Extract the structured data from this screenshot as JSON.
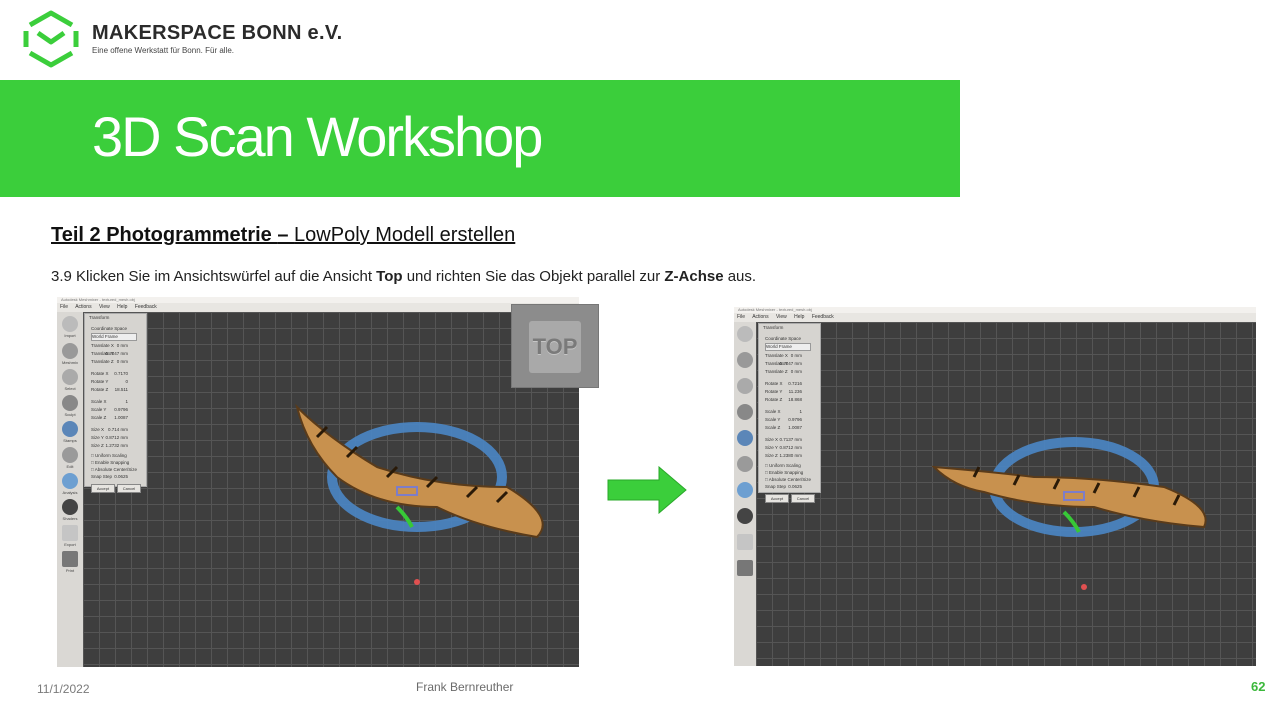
{
  "header": {
    "org_name": "MAKERSPACE BONN e.V.",
    "tagline": "Eine offene Werkstatt für Bonn. Für alle.",
    "brand_color": "#3bce3b"
  },
  "banner": {
    "title": "3D Scan Workshop"
  },
  "section": {
    "subtitle_bold": "Teil 2  Photogrammetrie ",
    "subtitle_dash": "– ",
    "subtitle_rest": "LowPoly Modell erstellen"
  },
  "instruction": {
    "part1": "3.9 Klicken Sie im Ansichtswürfel auf die Ansicht ",
    "bold1": "Top",
    "part2": " und richten Sie das Objekt parallel zur ",
    "bold2": "Z-Achse",
    "part3": " aus."
  },
  "screenshot_left": {
    "window_title": "Autodesk Meshmixer - textured_mesh.obj",
    "menu": [
      "File",
      "Actions",
      "View",
      "Help",
      "Feedback"
    ],
    "panel": {
      "title": "Transform",
      "coord_label": "Coordinate Space",
      "coord_value": "World Frame",
      "rows": [
        {
          "label": "Translate X",
          "value": "0",
          "unit": "mm"
        },
        {
          "label": "Translate Y",
          "value": "0.2047",
          "unit": "mm"
        },
        {
          "label": "Translate Z",
          "value": "0",
          "unit": "mm"
        },
        {
          "label": "Rotate X",
          "value": "0.7170",
          "unit": ""
        },
        {
          "label": "Rotate Y",
          "value": "0",
          "unit": ""
        },
        {
          "label": "Rotate Z",
          "value": "18.511",
          "unit": ""
        },
        {
          "label": "Scale X",
          "value": "1",
          "unit": ""
        },
        {
          "label": "Scale Y",
          "value": "0.9796",
          "unit": ""
        },
        {
          "label": "Scale Z",
          "value": "1.0087",
          "unit": ""
        },
        {
          "label": "Size X",
          "value": "0.714",
          "unit": "mm"
        },
        {
          "label": "Size Y",
          "value": "0.8712",
          "unit": "mm"
        },
        {
          "label": "Size Z",
          "value": "1.2732",
          "unit": "mm"
        }
      ],
      "checkboxes": [
        "Uniform Scaling",
        "Enable Snapping",
        "Absolute Center/Size"
      ],
      "snap_label": "Snap Step",
      "snap_value": "0.0625",
      "accept": "Accept",
      "cancel": "Cancel"
    },
    "viewcube_label": "TOP"
  },
  "screenshot_right": {
    "window_title": "Autodesk Meshmixer - textured_mesh.obj",
    "menu": [
      "File",
      "Actions",
      "View",
      "Help",
      "Feedback"
    ],
    "panel": {
      "title": "Transform",
      "coord_label": "Coordinate Space",
      "coord_value": "World Frame",
      "rows": [
        {
          "label": "Translate X",
          "value": "0",
          "unit": "mm"
        },
        {
          "label": "Translate Y",
          "value": "0.2047",
          "unit": "mm"
        },
        {
          "label": "Translate Z",
          "value": "0",
          "unit": "mm"
        },
        {
          "label": "Rotate X",
          "value": "0.7216",
          "unit": ""
        },
        {
          "label": "Rotate Y",
          "value": "11.236",
          "unit": ""
        },
        {
          "label": "Rotate Z",
          "value": "18.868",
          "unit": ""
        },
        {
          "label": "Scale X",
          "value": "1",
          "unit": ""
        },
        {
          "label": "Scale Y",
          "value": "0.9796",
          "unit": ""
        },
        {
          "label": "Scale Z",
          "value": "1.0087",
          "unit": ""
        },
        {
          "label": "Size X",
          "value": "0.7137",
          "unit": "mm"
        },
        {
          "label": "Size Y",
          "value": "0.8712",
          "unit": "mm"
        },
        {
          "label": "Size Z",
          "value": "1.2380",
          "unit": "mm"
        }
      ],
      "checkboxes": [
        "Uniform Scaling",
        "Enable Snapping",
        "Absolute Center/Size"
      ],
      "snap_label": "Snap Step",
      "snap_value": "0.0625",
      "accept": "Accept",
      "cancel": "Cancel"
    }
  },
  "tools": [
    "Import",
    "Meshmix",
    "Select",
    "Sculpt",
    "Stamps",
    "Edit",
    "Analysis",
    "Shaders",
    "Export",
    "Print"
  ],
  "footer": {
    "date": "11/1/2022",
    "author": "Frank Bernreuther",
    "page": "62"
  }
}
